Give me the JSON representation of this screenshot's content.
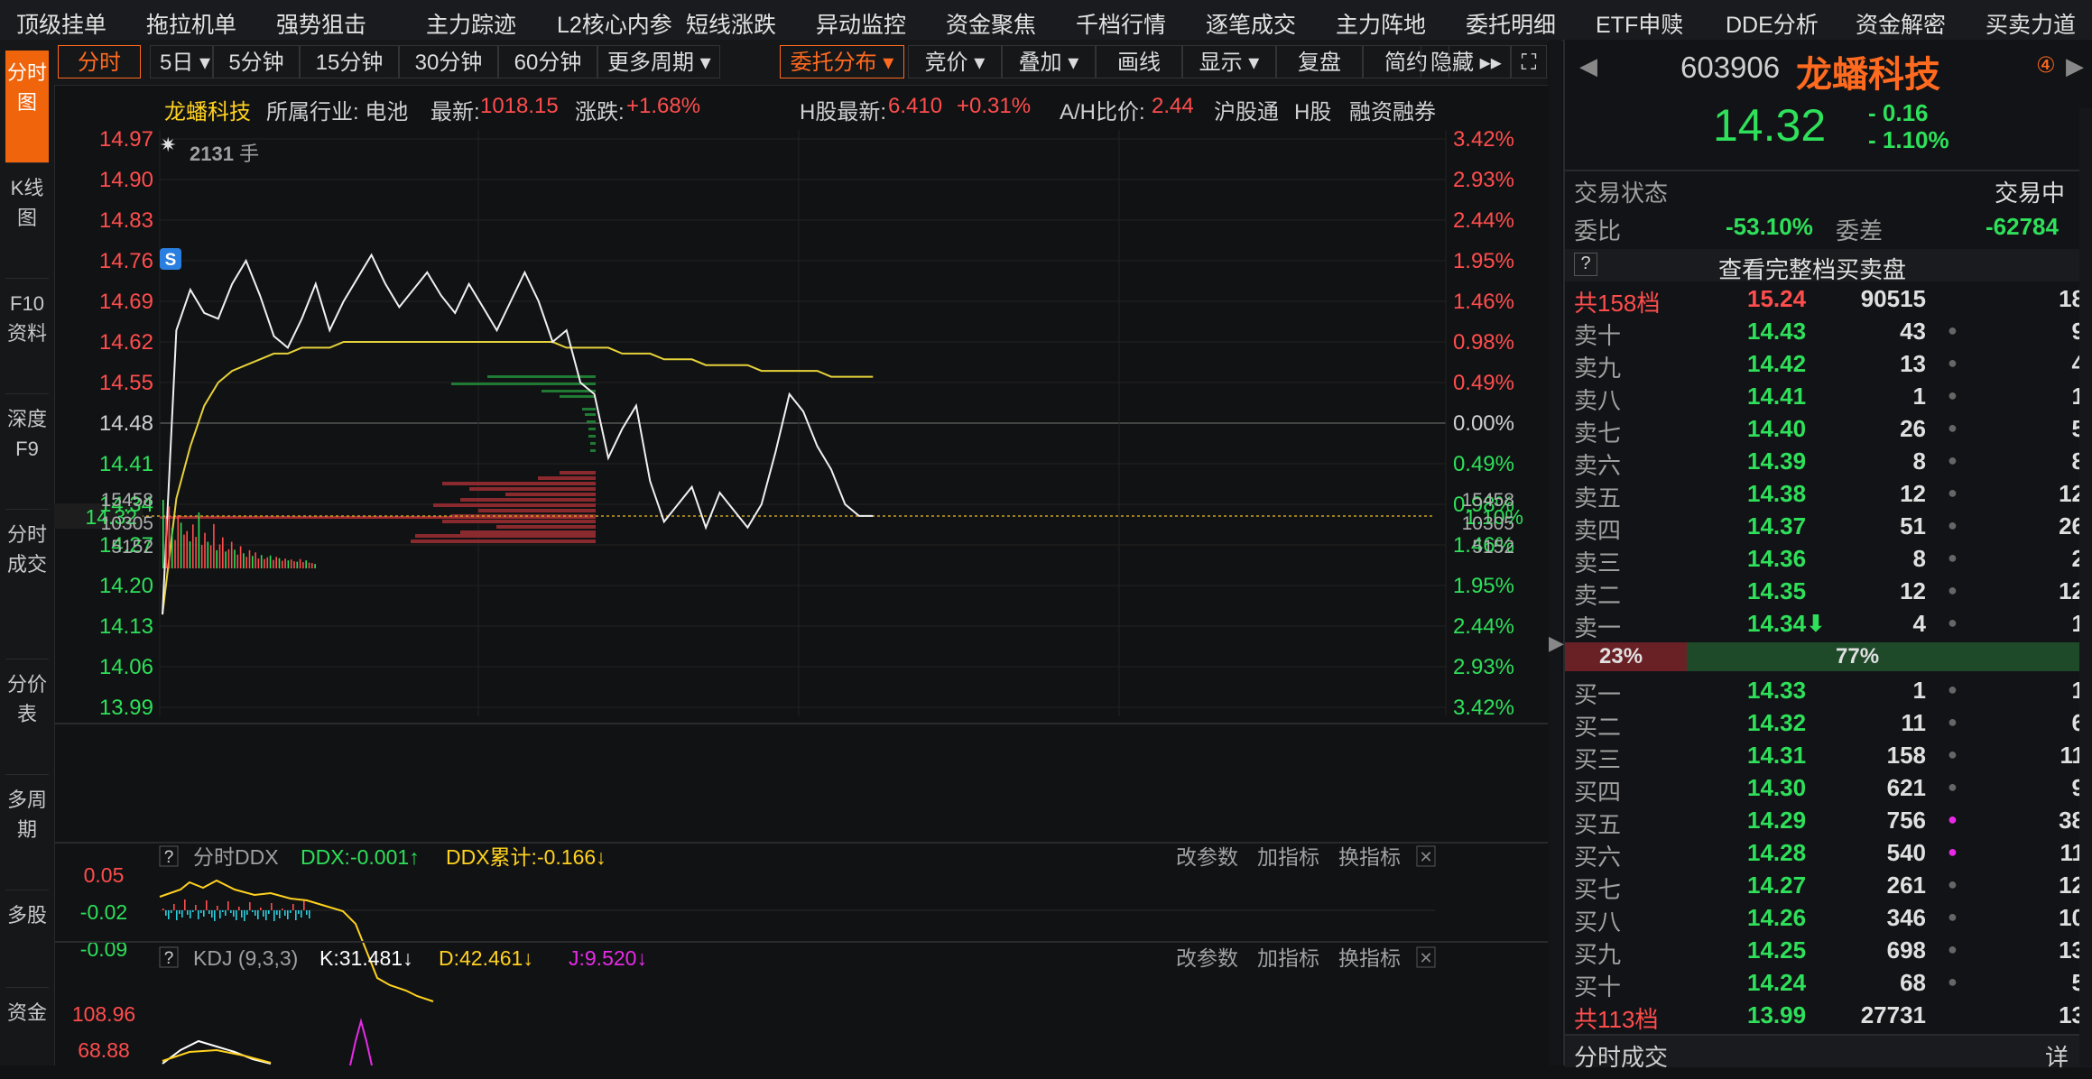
{
  "top_menu": [
    "顶级挂单",
    "拖拉机单",
    "强势狙击",
    "主力踪迹",
    "L2核心内参",
    "短线涨跌",
    "异动监控",
    "资金聚焦",
    "千档行情",
    "逐笔成交",
    "主力阵地",
    "委托明细",
    "ETF申赎",
    "DDE分析",
    "资金解密",
    "买卖力道"
  ],
  "left_nav": [
    "分时图",
    "K线图",
    "F10资料",
    "深度F9",
    "分时成交",
    "分价表",
    "多周期",
    "多股",
    "资金"
  ],
  "tabs": {
    "left": [
      "分时",
      "5日",
      "5分钟",
      "15分钟",
      "30分钟",
      "60分钟",
      "更多周期"
    ],
    "right": [
      "委托分布",
      "竞价",
      "叠加",
      "画线",
      "显示",
      "复盘",
      "简约",
      "隐藏"
    ]
  },
  "info": {
    "name": "龙蟠科技",
    "industry": "所属行业: 电池",
    "latest_label": "最新:",
    "latest_value": "1018.15",
    "change_label": "涨跌:",
    "change_value": "+1.68%",
    "h_label": "H股最新:",
    "h_value": "6.410",
    "h_change": "+0.31%",
    "ah_label": "A/H比价:",
    "ah_value": "2.44",
    "hgt": "沪股通",
    "hshare": "H股",
    "margin": "融资融券"
  },
  "price_axis": {
    "left": [
      "14.97",
      "14.90",
      "14.83",
      "14.76",
      "14.69",
      "14.62",
      "14.55",
      "14.48",
      "14.41",
      "14.34",
      "14.27",
      "14.20",
      "14.13",
      "14.06",
      "13.99"
    ],
    "right": [
      "3.42%",
      "2.93%",
      "2.44%",
      "1.95%",
      "1.46%",
      "0.98%",
      "0.49%",
      "0.00%",
      "0.49%",
      "0.98%",
      "1.46%",
      "1.95%",
      "2.44%",
      "2.93%",
      "3.42%"
    ],
    "current_price": "14.32",
    "current_pct": "1.10%",
    "volume_hint": "2131",
    "volume_unit": "手",
    "badge": "S"
  },
  "chart_data": {
    "type": "line",
    "x": [
      0,
      1,
      2,
      3,
      4,
      5,
      6,
      7,
      8,
      9,
      10,
      11,
      12,
      13,
      14,
      15,
      16,
      17,
      18,
      19,
      20,
      21,
      22,
      23,
      24,
      25,
      26,
      27,
      28,
      29,
      30,
      31,
      32,
      33,
      34,
      35,
      36,
      37,
      38,
      39,
      40,
      41,
      42,
      43,
      44,
      45,
      46,
      47,
      48,
      49,
      50,
      51,
      52,
      53,
      54,
      55,
      56,
      57,
      58,
      59,
      60,
      61,
      62,
      63,
      64,
      65,
      66,
      67,
      68,
      69
    ],
    "series": [
      {
        "values": [
          14.15,
          14.64,
          14.71,
          14.67,
          14.66,
          14.72,
          14.76,
          14.7,
          14.63,
          14.61,
          14.66,
          14.72,
          14.64,
          14.69,
          14.73,
          14.77,
          14.72,
          14.68,
          14.71,
          14.74,
          14.7,
          14.67,
          14.72,
          14.68,
          14.64,
          14.69,
          14.74,
          14.69,
          14.62,
          14.64,
          14.55,
          14.53,
          14.42,
          14.47,
          14.51,
          14.38,
          14.31,
          14.34,
          14.37,
          14.3,
          14.36,
          14.33,
          14.3,
          14.34,
          14.43,
          14.53,
          14.5,
          14.44,
          14.4,
          14.34,
          14.32,
          14.32
        ]
      },
      {
        "values": [
          14.15,
          14.35,
          14.44,
          14.51,
          14.55,
          14.57,
          14.58,
          14.59,
          14.6,
          14.6,
          14.61,
          14.61,
          14.61,
          14.62,
          14.62,
          14.62,
          14.62,
          14.62,
          14.62,
          14.62,
          14.62,
          14.62,
          14.62,
          14.62,
          14.62,
          14.62,
          14.62,
          14.62,
          14.62,
          14.61,
          14.61,
          14.61,
          14.61,
          14.6,
          14.6,
          14.6,
          14.59,
          14.59,
          14.59,
          14.58,
          14.58,
          14.58,
          14.58,
          14.57,
          14.57,
          14.57,
          14.57,
          14.57,
          14.56,
          14.56,
          14.56,
          14.56
        ]
      }
    ],
    "ylim": [
      13.99,
      14.97
    ],
    "grid": true
  },
  "volume_axis": [
    "15458",
    "10305",
    "5152"
  ],
  "volume_data": [
    15458,
    11200,
    14000,
    9100,
    6400,
    12000,
    10300,
    7600,
    8400,
    6100,
    9900,
    7100,
    12600,
    5300,
    8000,
    6000,
    5200,
    10000,
    4100,
    5400,
    7000,
    3800,
    4300,
    6000,
    4200,
    3100,
    5000,
    3400,
    2600,
    4100,
    2800,
    3600,
    2200,
    3000,
    2100,
    2500,
    2900,
    1900,
    2600,
    2300,
    1700,
    2200,
    1800,
    2000,
    1600,
    1500,
    2100,
    1400,
    1800,
    1300,
    1200,
    1000
  ],
  "ddx": {
    "help": "?",
    "title": "分时DDX",
    "ddx": "DDX:-0.001↑",
    "ddx_sum": "DDX累计:-0.166↓",
    "axis": [
      "0.05",
      "-0.02",
      "-0.09"
    ],
    "buttons": [
      "改参数",
      "加指标",
      "换指标"
    ]
  },
  "kdj": {
    "help": "?",
    "title": "KDJ (9,3,3)",
    "k": "K:31.481↓",
    "d": "D:42.461↓",
    "j": "J:9.520↓",
    "axis": [
      "108.96",
      "68.88"
    ],
    "buttons": [
      "改参数",
      "加指标",
      "换指标"
    ]
  },
  "quote": {
    "code": "603906",
    "name": "龙蟠科技",
    "num_badge": "④",
    "price": "14.32",
    "change": "- 0.16",
    "pct": "- 1.10%",
    "status_label": "交易状态",
    "status": "交易中",
    "weibi_label": "委比",
    "weibi": "-53.10%",
    "weicha_label": "委差",
    "weicha": "-62784",
    "full_book": "查看完整档买卖盘",
    "sell_total": {
      "label": "共158档",
      "price": "15.24",
      "vol": "90515",
      "num": "18"
    },
    "sells": [
      {
        "label": "卖十",
        "price": "14.43",
        "vol": "43",
        "num": "9"
      },
      {
        "label": "卖九",
        "price": "14.42",
        "vol": "13",
        "num": "4"
      },
      {
        "label": "卖八",
        "price": "14.41",
        "vol": "1",
        "num": "1"
      },
      {
        "label": "卖七",
        "price": "14.40",
        "vol": "26",
        "num": "5"
      },
      {
        "label": "卖六",
        "price": "14.39",
        "vol": "8",
        "num": "8"
      },
      {
        "label": "卖五",
        "price": "14.38",
        "vol": "12",
        "num": "12"
      },
      {
        "label": "卖四",
        "price": "14.37",
        "vol": "51",
        "num": "26"
      },
      {
        "label": "卖三",
        "price": "14.36",
        "vol": "8",
        "num": "2"
      },
      {
        "label": "卖二",
        "price": "14.35",
        "vol": "12",
        "num": "12"
      },
      {
        "label": "卖一",
        "price": "14.34⬇",
        "vol": "4",
        "num": "1"
      }
    ],
    "ratio_left": "23%",
    "ratio_right": "77%",
    "buys": [
      {
        "label": "买一",
        "price": "14.33",
        "vol": "1",
        "num": "1"
      },
      {
        "label": "买二",
        "price": "14.32",
        "vol": "11",
        "num": "6"
      },
      {
        "label": "买三",
        "price": "14.31",
        "vol": "158",
        "num": "11"
      },
      {
        "label": "买四",
        "price": "14.30",
        "vol": "621",
        "num": "9"
      },
      {
        "label": "买五",
        "price": "14.29",
        "vol": "756",
        "num": "38"
      },
      {
        "label": "买六",
        "price": "14.28",
        "vol": "540",
        "num": "11"
      },
      {
        "label": "买七",
        "price": "14.27",
        "vol": "261",
        "num": "12"
      },
      {
        "label": "买八",
        "price": "14.26",
        "vol": "346",
        "num": "10"
      },
      {
        "label": "买九",
        "price": "14.25",
        "vol": "698",
        "num": "13"
      },
      {
        "label": "买十",
        "price": "14.24",
        "vol": "68",
        "num": "5"
      }
    ],
    "buy_total": {
      "label": "共113档",
      "price": "13.99",
      "vol": "27731",
      "num": "13"
    },
    "bottom_label": "分时成交",
    "bottom_more": "详"
  },
  "colors": {
    "red": "#ff4d4d",
    "green": "#2ee05a",
    "orange": "#ff6a1f",
    "yellow": "#ffd21f",
    "magenta": "#e82ae8",
    "cyan": "#2ad0e0"
  }
}
